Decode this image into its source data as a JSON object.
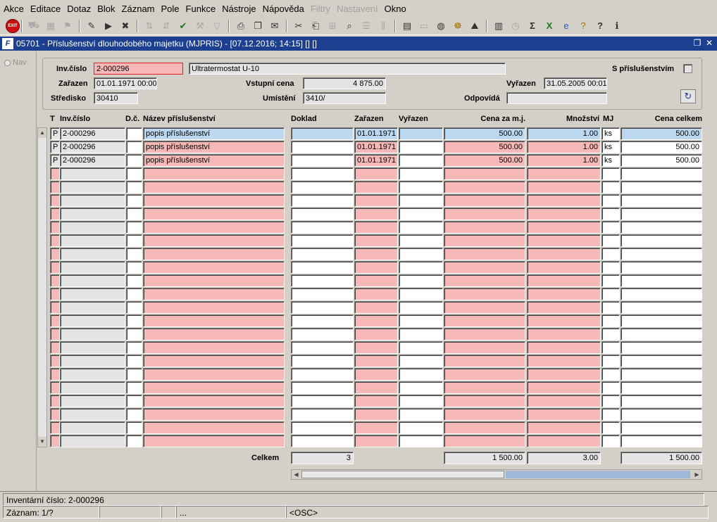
{
  "menu": [
    "Akce",
    "Editace",
    "Dotaz",
    "Blok",
    "Záznam",
    "Pole",
    "Funkce",
    "Nástroje",
    "Nápověda",
    "Filtry",
    "Nastavení",
    "Okno"
  ],
  "menu_disabled": [
    "Filtry",
    "Nastavení"
  ],
  "toolbar": {
    "exit_label": "EXIT"
  },
  "window": {
    "icon": "F",
    "title": "05701 - Příslušenství dlouhodobého majetku (MJPRIS) - [07.12.2016; 14:15] [] []"
  },
  "nav": {
    "label": "Nav"
  },
  "header": {
    "inv_label": "Inv.číslo",
    "inv_value": "2-000296",
    "name_value": "Ultratermostat U-10",
    "s_prislus_label": "S příslušenstvím",
    "zarazen_label": "Zařazen",
    "zarazen_value": "01.01.1971 00:00",
    "vstupni_label": "Vstupní cena",
    "vstupni_value": "4 875.00",
    "vyrazen_label": "Vyřazen",
    "vyrazen_value": "31.05.2005 00:01",
    "stredisko_label": "Středisko",
    "stredisko_value": "30410",
    "umisteni_label": "Umístění",
    "umisteni_value": "3410/",
    "odpovida_label": "Odpovídá",
    "odpovida_value": ""
  },
  "grid": {
    "columns": [
      "T",
      "Inv.číslo",
      "D.č.",
      "Název příslušenství",
      "Doklad",
      "Zařazen",
      "Vyřazen",
      "Cena za m.j.",
      "Množství",
      "MJ",
      "Cena celkem"
    ],
    "rows": [
      {
        "t": "P",
        "inv": "2-000296",
        "dc": "",
        "nazev": "popis příslušenství",
        "doklad": "",
        "zarazen": "01.01.1971",
        "vyrazen": "",
        "cena": "500.00",
        "mnozstvi": "1.00",
        "mj": "ks",
        "celkem": "500.00"
      },
      {
        "t": "P",
        "inv": "2-000296",
        "dc": "",
        "nazev": "popis příslušenství",
        "doklad": "",
        "zarazen": "01.01.1971",
        "vyrazen": "",
        "cena": "500.00",
        "mnozstvi": "1.00",
        "mj": "ks",
        "celkem": "500.00"
      },
      {
        "t": "P",
        "inv": "2-000296",
        "dc": "",
        "nazev": "popis příslušenství",
        "doklad": "",
        "zarazen": "01.01.1971",
        "vyrazen": "",
        "cena": "500.00",
        "mnozstvi": "1.00",
        "mj": "ks",
        "celkem": "500.00"
      }
    ],
    "empty_rows": 21
  },
  "totals": {
    "label": "Celkem",
    "doklad": "3",
    "cena": "1 500.00",
    "mnozstvi": "3.00",
    "celkem": "1 500.00"
  },
  "status": {
    "line1": "Inventární číslo: 2-000296",
    "record": "Záznam: 1/?",
    "seg3": "...",
    "osc": "<OSC>"
  }
}
